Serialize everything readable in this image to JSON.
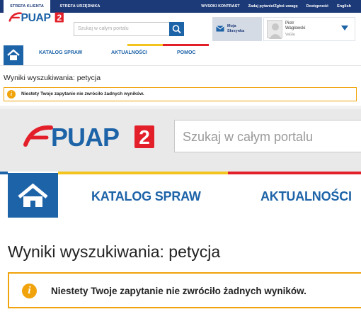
{
  "topbar": {
    "zone_tabs": [
      "STREFA KLIENTA",
      "STREFA URZĘDNIKA"
    ],
    "links": [
      "WYSOKI KONTRAST",
      "Zadaj pytanie/Zgłoś uwagę",
      "Dostępność",
      "English"
    ]
  },
  "logo": {
    "text": "ePUAP",
    "badge": "2",
    "alt": "ePUAP 2"
  },
  "search": {
    "placeholder": "Szukaj w całym portalu"
  },
  "inbox": {
    "label_line1": "Moja",
    "label_line2": "Skrzynka"
  },
  "user": {
    "first_name": "Piotr",
    "last_name": "Waglowski",
    "role": "VaGla"
  },
  "nav": {
    "items": [
      "KATALOG SPRAW",
      "AKTUALNOŚCI",
      "POMOC"
    ]
  },
  "colors": {
    "brand_blue": "#1d63a8",
    "dark_navy": "#1d3a78",
    "logo_red": "#e3202a",
    "warning_orange": "#f0a30a",
    "stripe_yellow": "#f3c31e",
    "stripe_red": "#e3202a"
  },
  "icons": {
    "home": "home-icon",
    "search": "search-icon",
    "mail": "mail-icon",
    "info": "info-icon",
    "chevron": "chevron-down-icon"
  },
  "results": {
    "title": "Wyniki wyszukiwania: petycja",
    "message": "Niestety Twoje zapytanie nie zwróciło żadnych wyników.",
    "icon_glyph": "i"
  }
}
